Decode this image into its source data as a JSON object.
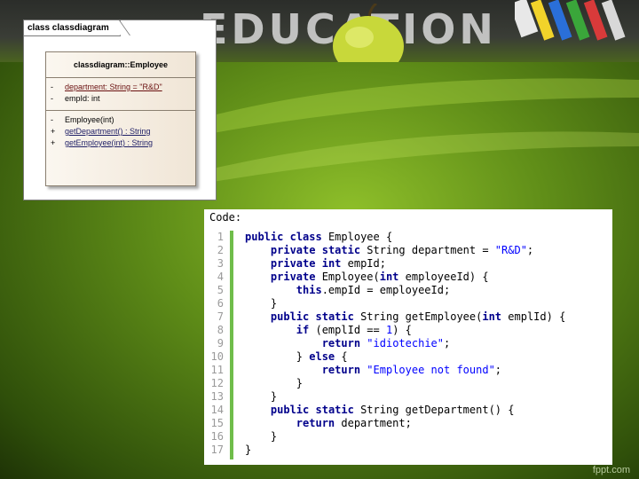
{
  "banner": {
    "word": "EDUCATION"
  },
  "uml": {
    "frame_title": "class classdiagram",
    "class_name": "classdiagram::Employee",
    "attributes": [
      {
        "vis": "-",
        "text": "department:  String = \"R&D\""
      },
      {
        "vis": "-",
        "text": "empId:  int"
      }
    ],
    "operations": [
      {
        "vis": "-",
        "text": "Employee(int)"
      },
      {
        "vis": "+",
        "text": "getDepartment() : String"
      },
      {
        "vis": "+",
        "text": "getEmployee(int) : String"
      }
    ]
  },
  "code": {
    "title": "Code:",
    "lines": [
      {
        "n": "1",
        "t": "public class Employee {"
      },
      {
        "n": "2",
        "t": "    private static String department = \"R&D\";"
      },
      {
        "n": "3",
        "t": "    private int empId;"
      },
      {
        "n": "4",
        "t": "    private Employee(int employeeId) {"
      },
      {
        "n": "5",
        "t": "        this.empId = employeeId;"
      },
      {
        "n": "6",
        "t": "    }"
      },
      {
        "n": "7",
        "t": "    public static String getEmployee(int emplId) {"
      },
      {
        "n": "8",
        "t": "        if (emplId == 1) {"
      },
      {
        "n": "9",
        "t": "            return \"idiotechie\";"
      },
      {
        "n": "10",
        "t": "        } else {"
      },
      {
        "n": "11",
        "t": "            return \"Employee not found\";"
      },
      {
        "n": "12",
        "t": "        }"
      },
      {
        "n": "13",
        "t": "    }"
      },
      {
        "n": "14",
        "t": "    public static String getDepartment() {"
      },
      {
        "n": "15",
        "t": "        return department;"
      },
      {
        "n": "16",
        "t": "    }"
      },
      {
        "n": "17",
        "t": "}"
      }
    ]
  },
  "watermark": "fppt.com",
  "colors": {
    "gutter": "#6fbd4a",
    "keyword": "#00008b",
    "string": "#0000ff",
    "line_number": "#9a9a9a"
  }
}
